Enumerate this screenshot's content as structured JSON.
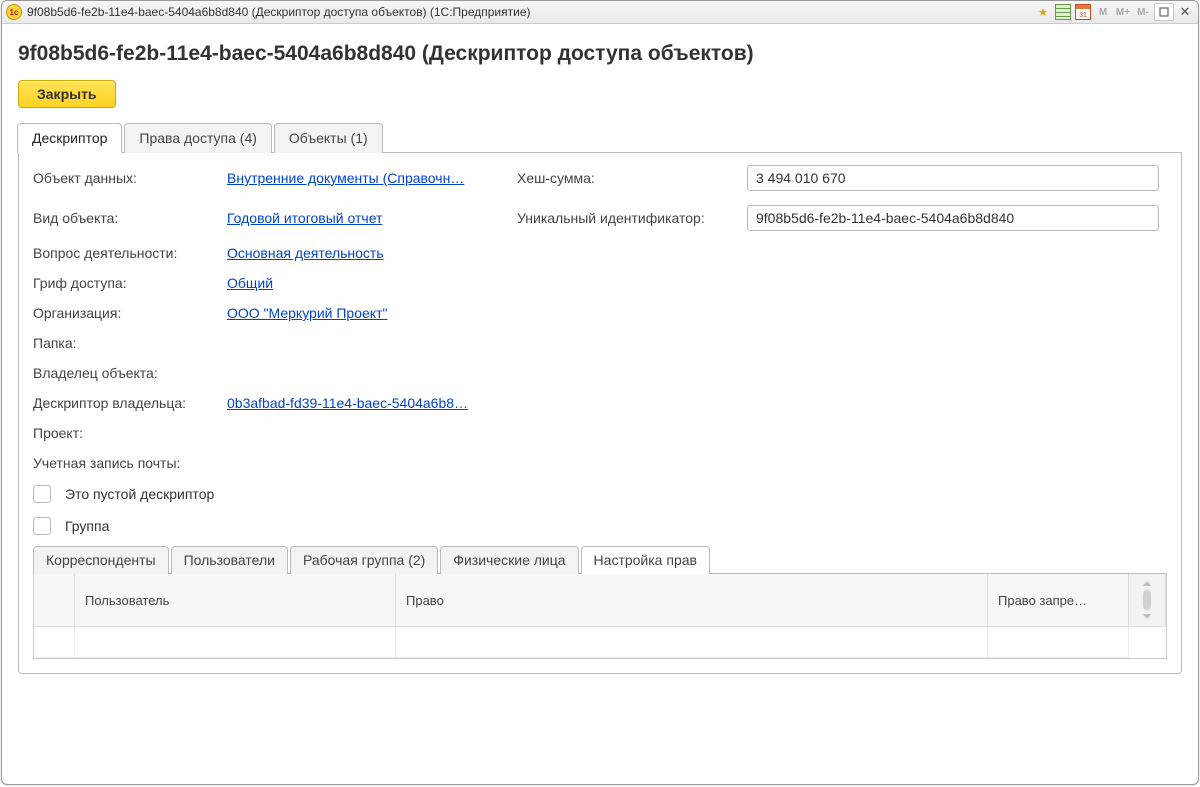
{
  "titlebar": {
    "app_icon_text": "1c",
    "title": "9f08b5d6-fe2b-11e4-baec-5404a6b8d840 (Дескриптор доступа объектов)  (1С:Предприятие)",
    "cal_text": "31",
    "m_labels": [
      "M",
      "M+",
      "M-"
    ]
  },
  "page_title": "9f08b5d6-fe2b-11e4-baec-5404a6b8d840 (Дескриптор доступа объектов)",
  "close_button": "Закрыть",
  "tabs": {
    "descriptor": "Дескриптор",
    "rights": "Права доступа (4)",
    "objects": "Объекты (1)"
  },
  "form": {
    "labels": {
      "data_object": "Объект данных:",
      "hash": "Хеш-сумма:",
      "object_kind": "Вид объекта:",
      "uid": "Уникальный идентификатор:",
      "activity": "Вопрос деятельности:",
      "access_stamp": "Гриф доступа:",
      "organization": "Организация:",
      "folder": "Папка:",
      "owner": "Владелец объекта:",
      "owner_descriptor": "Дескриптор владельца:",
      "project": "Проект:",
      "mail_account": "Учетная запись почты:",
      "empty_descriptor": "Это пустой дескриптор",
      "group": "Группа"
    },
    "values": {
      "data_object": "Внутренние документы (Справочн…",
      "hash": "3 494 010 670",
      "object_kind": "Годовой итоговый отчет",
      "uid": "9f08b5d6-fe2b-11e4-baec-5404a6b8d840",
      "activity": "Основная деятельность",
      "access_stamp": "Общий",
      "organization": "ООО \"Меркурий Проект\"",
      "owner_descriptor": "0b3afbad-fd39-11e4-baec-5404a6b8…"
    }
  },
  "inner_tabs": {
    "correspondents": "Корреспонденты",
    "users": "Пользователи",
    "workgroup": "Рабочая группа (2)",
    "persons": "Физические лица",
    "rights_setup": "Настройка прав"
  },
  "inner_table": {
    "headers": {
      "user": "Пользователь",
      "right": "Право",
      "right_denied": "Право запре…"
    }
  }
}
